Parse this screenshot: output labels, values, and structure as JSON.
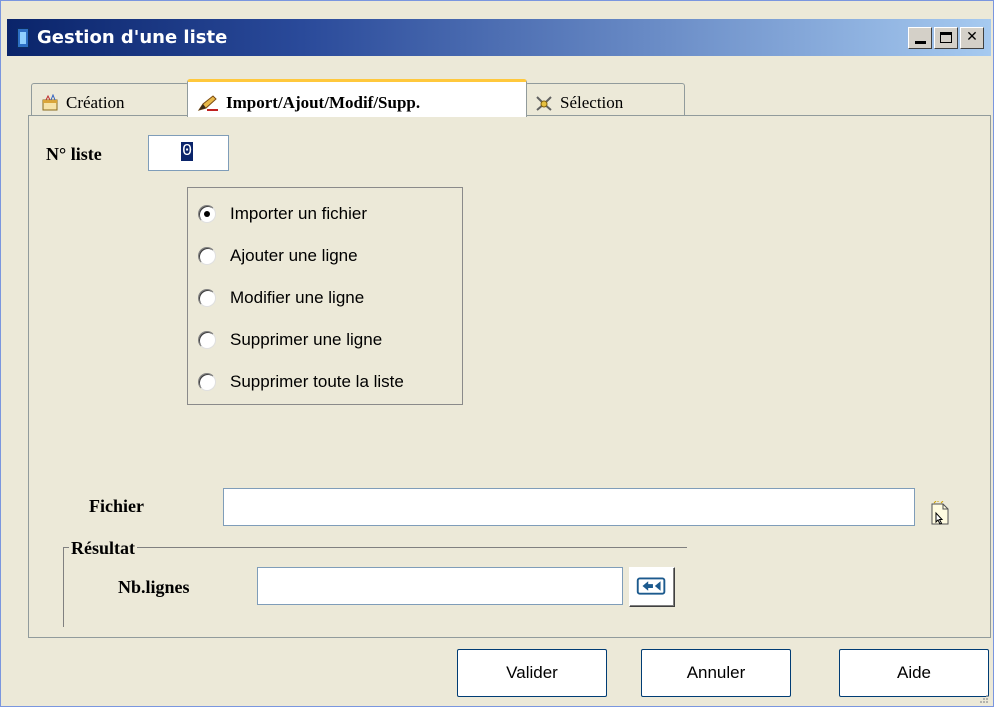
{
  "window": {
    "title": "Gestion d'une liste",
    "icon": "list-window-icon",
    "controls": {
      "minimize": "minimize-icon",
      "maximize": "maximize-icon",
      "close": "✕"
    }
  },
  "tabs": [
    {
      "label": "Création",
      "icon": "wand-hat-icon",
      "active": false
    },
    {
      "label": "Import/Ajout/Modif/Supp.",
      "icon": "pencil-edit-icon",
      "active": true
    },
    {
      "label": "Sélection",
      "icon": "selection-tools-icon",
      "active": false
    }
  ],
  "form": {
    "nliste_label": "N° liste",
    "nliste_value": "0",
    "options": [
      {
        "label": "Importer un fichier",
        "checked": true
      },
      {
        "label": "Ajouter une ligne",
        "checked": false
      },
      {
        "label": "Modifier une ligne",
        "checked": false
      },
      {
        "label": "Supprimer une ligne",
        "checked": false
      },
      {
        "label": "Supprimer toute la liste",
        "checked": false
      }
    ],
    "fichier_label": "Fichier",
    "fichier_value": "",
    "browse_icon": "browse-file-icon",
    "resultat_label": "Résultat",
    "nblignes_label": "Nb.lignes",
    "nblignes_value": "",
    "go_icon": "arrow-go-icon"
  },
  "buttons": {
    "valider": "Valider",
    "annuler": "Annuler",
    "aide": "Aide"
  },
  "colors": {
    "titlebar_start": "#0a246a",
    "titlebar_end": "#a6caf0",
    "dialog_bg": "#ece9d8",
    "active_tab_accent": "#ffc83c"
  }
}
